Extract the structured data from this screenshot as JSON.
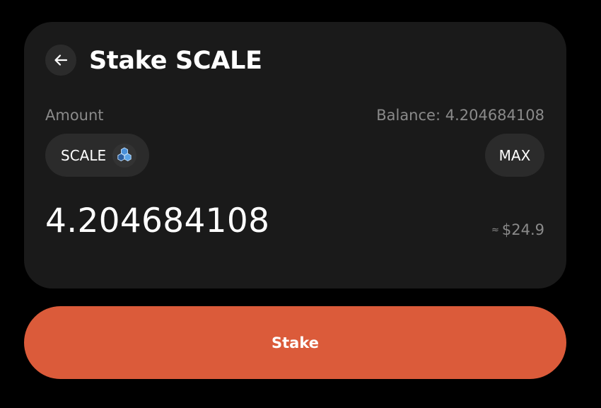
{
  "header": {
    "title": "Stake SCALE",
    "back_icon": "arrow-left-icon"
  },
  "amount": {
    "label": "Amount",
    "balance": "Balance: 4.204684108",
    "value": "4.204684108",
    "usd_approx_symbol": "≈",
    "usd_value": "$24.9"
  },
  "token": {
    "symbol": "SCALE",
    "icon": "skale-hexagon-icon"
  },
  "max_button": {
    "label": "MAX"
  },
  "stake_button": {
    "label": "Stake"
  },
  "colors": {
    "background": "#000000",
    "card": "#1a1a1a",
    "pill": "#2b2b2b",
    "muted_text": "#8a8a8a",
    "accent": "#db5b3a"
  }
}
